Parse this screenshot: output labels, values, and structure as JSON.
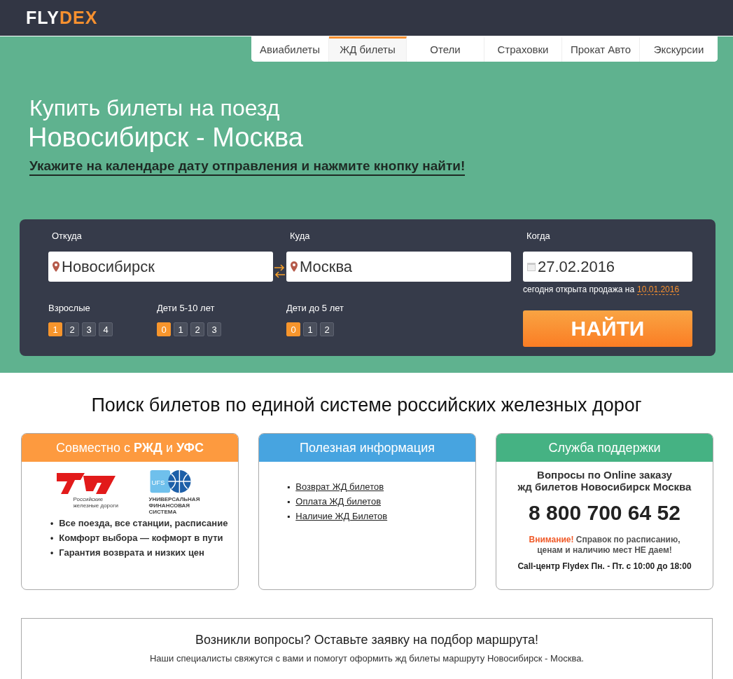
{
  "header": {
    "logo": [
      {
        "text": "FLY",
        "accent": false
      },
      {
        "text": "DEX",
        "accent": true
      }
    ]
  },
  "nav": [
    {
      "label": "Авиабилеты",
      "selected": false
    },
    {
      "label": "ЖД билеты",
      "selected": true
    },
    {
      "label": "Отели",
      "selected": false
    },
    {
      "label": "Страховки",
      "selected": false
    },
    {
      "label": "Прокат Авто",
      "selected": false
    },
    {
      "label": "Экскурсии",
      "selected": false
    }
  ],
  "hero": {
    "title": "Купить билеты на поезд",
    "route": "Новосибирск - Москва",
    "instruction": "Укажите на календаре дату отправления и нажмите кнопку найти!"
  },
  "search": {
    "from": {
      "label": "Откуда",
      "value": "Новосибирск"
    },
    "to": {
      "label": "Куда",
      "value": "Москва"
    },
    "date": {
      "label": "Когда",
      "value": "27.02.2016",
      "note": "сегодня открыта продажа на",
      "sale_date": "10.01.2016"
    },
    "passengers": [
      {
        "label": "Взрослые",
        "options": [
          {
            "label": "1",
            "selected": true
          },
          {
            "label": "2",
            "selected": false
          },
          {
            "label": "3",
            "selected": false
          },
          {
            "label": "4",
            "selected": false
          }
        ]
      },
      {
        "label": "Дети 5-10 лет",
        "options": [
          {
            "label": "0",
            "selected": true
          },
          {
            "label": "1",
            "selected": false
          },
          {
            "label": "2",
            "selected": false
          },
          {
            "label": "3",
            "selected": false
          }
        ]
      },
      {
        "label": "Дети до 5 лет",
        "options": [
          {
            "label": "0",
            "selected": true
          },
          {
            "label": "1",
            "selected": false
          },
          {
            "label": "2",
            "selected": false
          }
        ]
      }
    ],
    "button": "НАЙТИ"
  },
  "section_title": "Поиск билетов по единой системе российских железных дорог",
  "cards": [
    {
      "kind": "partners",
      "title": "Совместно с **РЖД** и **УФС**",
      "color": "#fd9a3f",
      "rzd_caption": "Российские железные дороги",
      "ufs_mark": "UFS",
      "ufs_caption": "УНИВЕРСАЛЬНАЯ ФИНАНСОВАЯ СИСТЕМА",
      "marker": "•",
      "bullets": [
        "Все поезда, все станции, расписание",
        "Комфорт выбора — кофморт в пути",
        "Гарантия возврата и низких цен"
      ]
    },
    {
      "kind": "links",
      "title": "Полезная информация",
      "color": "#47a4e0",
      "marker": "▪",
      "links": [
        "Возврат ЖД билетов",
        "Оплата ЖД билетов",
        "Наличие ЖД Билетов"
      ]
    },
    {
      "kind": "support",
      "title": "Служба поддержки",
      "color": "#45b283",
      "question": [
        "Вопросы по Online заказу",
        "жд билетов Новосибирск Москва"
      ],
      "phone": "8 800 700 64 52",
      "notice": "**Внимание!** Справок по расписанию, ценам и наличию мест НЕ даем!",
      "hours": "Call-центр Flydex Пн. - Пт. с 10:00 до 18:00"
    }
  ],
  "callout": {
    "title": "Возникли вопросы? Оставьте заявку на подбор маршрута!",
    "text": "Наши специалисты свяжутся с вами и помогут оформить жд билеты маршруту Новосибирск - Москва."
  }
}
